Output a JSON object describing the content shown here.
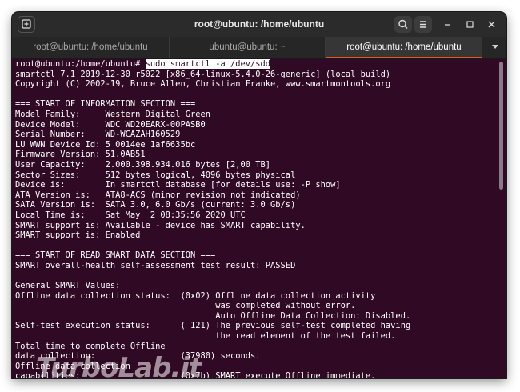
{
  "window": {
    "title": "root@ubuntu: /home/ubuntu"
  },
  "tabs": [
    {
      "label": "root@ubuntu: /home/ubuntu",
      "active": false
    },
    {
      "label": "ubuntu@ubuntu: ~",
      "active": false
    },
    {
      "label": "root@ubuntu: /home/ubuntu",
      "active": true
    }
  ],
  "icons": {
    "new_tab": "new-tab-icon",
    "search": "search-icon",
    "menu": "hamburger-menu-icon",
    "minimize": "minimize-icon",
    "maximize": "maximize-icon",
    "close": "close-icon",
    "dropdown": "chevron-down-icon"
  },
  "colors": {
    "terminal_bg": "#300a24",
    "accent": "#e95420",
    "titlebar": "#2b2b2b"
  },
  "terminal": {
    "prompt": "root@ubuntu:/home/ubuntu# ",
    "command": "sudo smartctl -a /dev/sdd",
    "lines": [
      "smartctl 7.1 2019-12-30 r5022 [x86_64-linux-5.4.0-26-generic] (local build)",
      "Copyright (C) 2002-19, Bruce Allen, Christian Franke, www.smartmontools.org",
      "",
      "=== START OF INFORMATION SECTION ===",
      "Model Family:     Western Digital Green",
      "Device Model:     WDC WD20EARX-00PASB0",
      "Serial Number:    WD-WCAZAH160529",
      "LU WWN Device Id: 5 0014ee 1af6635bc",
      "Firmware Version: 51.0AB51",
      "User Capacity:    2.000.398.934.016 bytes [2,00 TB]",
      "Sector Sizes:     512 bytes logical, 4096 bytes physical",
      "Device is:        In smartctl database [for details use: -P show]",
      "ATA Version is:   ATA8-ACS (minor revision not indicated)",
      "SATA Version is:  SATA 3.0, 6.0 Gb/s (current: 3.0 Gb/s)",
      "Local Time is:    Sat May  2 08:35:56 2020 UTC",
      "SMART support is: Available - device has SMART capability.",
      "SMART support is: Enabled",
      "",
      "=== START OF READ SMART DATA SECTION ===",
      "SMART overall-health self-assessment test result: PASSED",
      "",
      "General SMART Values:",
      "Offline data collection status:  (0x02) Offline data collection activity",
      "                                        was completed without error.",
      "                                        Auto Offline Data Collection: Disabled.",
      "Self-test execution status:      ( 121) The previous self-test completed having",
      "                                        the read element of the test failed.",
      "Total time to complete Offline",
      "data collection:                 (37980) seconds.",
      "Offline data collection",
      "capabilities:                    (0x7b) SMART execute Offline immediate."
    ]
  },
  "watermark": "TurboLab.it"
}
